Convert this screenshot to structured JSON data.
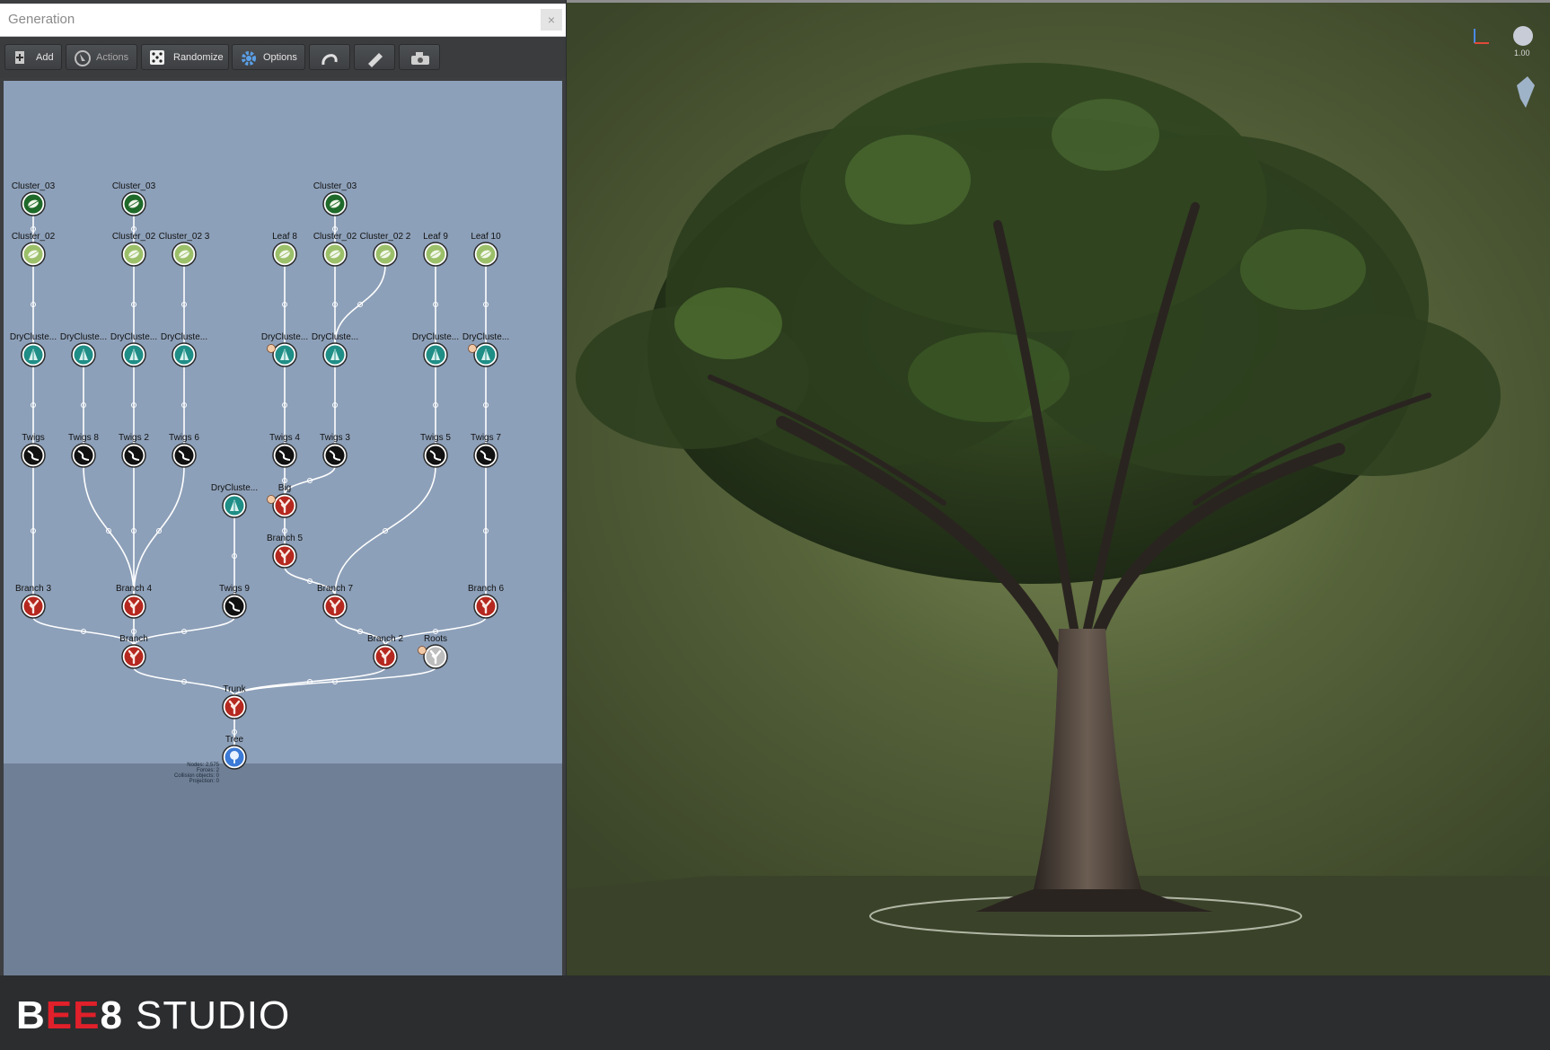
{
  "window": {
    "title": "Generation",
    "close": "×"
  },
  "toolbar": {
    "add_label": "Add",
    "actions_label": "Actions",
    "randomize_label": "Randomize",
    "options_label": "Options"
  },
  "nodes": [
    {
      "id": "c03a",
      "label": "Cluster_03",
      "type": "cluster3",
      "col": 0,
      "row": 0
    },
    {
      "id": "c03b",
      "label": "Cluster_03",
      "type": "cluster3",
      "col": 2,
      "row": 0
    },
    {
      "id": "c03c",
      "label": "Cluster_03",
      "type": "cluster3",
      "col": 6,
      "row": 0
    },
    {
      "id": "c02a",
      "label": "Cluster_02",
      "type": "cluster2",
      "col": 0,
      "row": 1
    },
    {
      "id": "c02b",
      "label": "Cluster_02",
      "type": "cluster2",
      "col": 2,
      "row": 1
    },
    {
      "id": "c023",
      "label": "Cluster_02 3",
      "type": "cluster2",
      "col": 3,
      "row": 1
    },
    {
      "id": "l8",
      "label": "Leaf 8",
      "type": "cluster2",
      "col": 5,
      "row": 1
    },
    {
      "id": "c02c",
      "label": "Cluster_02",
      "type": "cluster2",
      "col": 6,
      "row": 1
    },
    {
      "id": "c022",
      "label": "Cluster_02 2",
      "type": "cluster2",
      "col": 7,
      "row": 1
    },
    {
      "id": "l9",
      "label": "Leaf 9",
      "type": "cluster2",
      "col": 8,
      "row": 1
    },
    {
      "id": "l10",
      "label": "Leaf 10",
      "type": "cluster2",
      "col": 9,
      "row": 1
    },
    {
      "id": "d1",
      "label": "DryCluste...",
      "type": "dry",
      "col": 0,
      "row": 3
    },
    {
      "id": "d2",
      "label": "DryCluste...",
      "type": "dry",
      "col": 1,
      "row": 3
    },
    {
      "id": "d3",
      "label": "DryCluste...",
      "type": "dry",
      "col": 2,
      "row": 3
    },
    {
      "id": "d4",
      "label": "DryCluste...",
      "type": "dry",
      "col": 3,
      "row": 3
    },
    {
      "id": "d5",
      "label": "DryCluste...",
      "type": "dry",
      "col": 5,
      "row": 3,
      "badge": true
    },
    {
      "id": "d6",
      "label": "DryCluste...",
      "type": "dry",
      "col": 6,
      "row": 3
    },
    {
      "id": "d7",
      "label": "DryCluste...",
      "type": "dry",
      "col": 8,
      "row": 3
    },
    {
      "id": "d8",
      "label": "DryCluste...",
      "type": "dry",
      "col": 9,
      "row": 3,
      "badge": true
    },
    {
      "id": "t1",
      "label": "Twigs",
      "type": "twig",
      "col": 0,
      "row": 5
    },
    {
      "id": "t8",
      "label": "Twigs 8",
      "type": "twig",
      "col": 1,
      "row": 5
    },
    {
      "id": "t2",
      "label": "Twigs 2",
      "type": "twig",
      "col": 2,
      "row": 5
    },
    {
      "id": "t6",
      "label": "Twigs 6",
      "type": "twig",
      "col": 3,
      "row": 5
    },
    {
      "id": "t4",
      "label": "Twigs 4",
      "type": "twig",
      "col": 5,
      "row": 5
    },
    {
      "id": "t3",
      "label": "Twigs 3",
      "type": "twig",
      "col": 6,
      "row": 5
    },
    {
      "id": "t5",
      "label": "Twigs 5",
      "type": "twig",
      "col": 8,
      "row": 5
    },
    {
      "id": "t7",
      "label": "Twigs 7",
      "type": "twig",
      "col": 9,
      "row": 5
    },
    {
      "id": "d9",
      "label": "DryCluste...",
      "type": "dry",
      "col": 4,
      "row": 6
    },
    {
      "id": "big",
      "label": "Big",
      "type": "branch",
      "col": 5,
      "row": 6,
      "badge": true
    },
    {
      "id": "b5",
      "label": "Branch 5",
      "type": "branch",
      "col": 5,
      "row": 7
    },
    {
      "id": "b3",
      "label": "Branch 3",
      "type": "branch",
      "col": 0,
      "row": 8
    },
    {
      "id": "b4",
      "label": "Branch 4",
      "type": "branch",
      "col": 2,
      "row": 8
    },
    {
      "id": "t9",
      "label": "Twigs 9",
      "type": "twig",
      "col": 4,
      "row": 8
    },
    {
      "id": "b7",
      "label": "Branch 7",
      "type": "branch",
      "col": 6,
      "row": 8
    },
    {
      "id": "b6",
      "label": "Branch 6",
      "type": "branch",
      "col": 9,
      "row": 8
    },
    {
      "id": "br",
      "label": "Branch",
      "type": "branch",
      "col": 2,
      "row": 9
    },
    {
      "id": "b2",
      "label": "Branch 2",
      "type": "branch",
      "col": 7,
      "row": 9
    },
    {
      "id": "roots",
      "label": "Roots",
      "type": "roots",
      "col": 8,
      "row": 9,
      "badge": true
    },
    {
      "id": "trunk",
      "label": "Trunk",
      "type": "branch",
      "col": 4,
      "row": 10
    },
    {
      "id": "tree",
      "label": "Tree",
      "type": "tree",
      "col": 4,
      "row": 11
    }
  ],
  "edges": [
    [
      "c03a",
      "c02a"
    ],
    [
      "c03b",
      "c02b"
    ],
    [
      "c03c",
      "c02c"
    ],
    [
      "c02a",
      "d1"
    ],
    [
      "c02b",
      "d3"
    ],
    [
      "c023",
      "d4"
    ],
    [
      "l8",
      "d5"
    ],
    [
      "c02c",
      "d6"
    ],
    [
      "c022",
      "d6"
    ],
    [
      "l9",
      "d7"
    ],
    [
      "l10",
      "d8"
    ],
    [
      "d1",
      "t1"
    ],
    [
      "d2",
      "t8"
    ],
    [
      "d3",
      "t2"
    ],
    [
      "d4",
      "t6"
    ],
    [
      "d5",
      "t4"
    ],
    [
      "d6",
      "t3"
    ],
    [
      "d7",
      "t5"
    ],
    [
      "d8",
      "t7"
    ],
    [
      "t1",
      "b3"
    ],
    [
      "t8",
      "b4"
    ],
    [
      "t2",
      "b4"
    ],
    [
      "t6",
      "b4"
    ],
    [
      "t4",
      "big"
    ],
    [
      "t3",
      "big"
    ],
    [
      "big",
      "b5"
    ],
    [
      "d9",
      "t9"
    ],
    [
      "b5",
      "b7"
    ],
    [
      "t5",
      "b7"
    ],
    [
      "t7",
      "b6"
    ],
    [
      "b3",
      "br"
    ],
    [
      "b4",
      "br"
    ],
    [
      "t9",
      "br"
    ],
    [
      "b7",
      "b2"
    ],
    [
      "b6",
      "b2"
    ],
    [
      "br",
      "trunk"
    ],
    [
      "b2",
      "trunk"
    ],
    [
      "roots",
      "trunk"
    ],
    [
      "trunk",
      "tree"
    ]
  ],
  "tree_stats": [
    "Nodes: 2,575",
    "Forces: 2",
    "Collision objects: 0",
    "Projection: 0"
  ],
  "viewport": {
    "zoom": "1.00"
  },
  "colors": {
    "graph_bg": "#8da0b9",
    "graph_floor": "#6f7f95",
    "cluster3": "#1f6a2a",
    "cluster2": "#9cc06a",
    "dry": "#1f8e86",
    "twig": "#111111",
    "branch": "#b5281f",
    "roots": "#bdbdbd",
    "tree": "#3b7ad6",
    "brand_accent": "#e0202a"
  },
  "brand": {
    "b": "B",
    "ee": "EE",
    "eight": "8",
    "studio": "STUDIO"
  }
}
